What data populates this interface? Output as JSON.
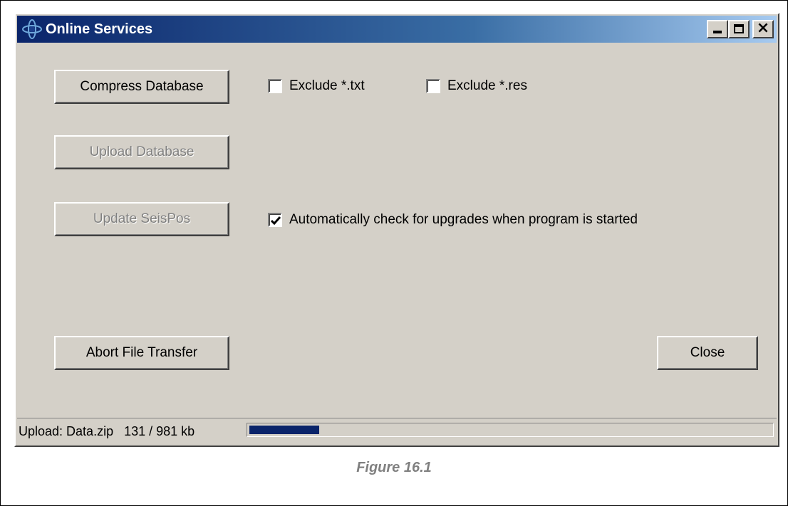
{
  "window": {
    "title": "Online Services",
    "icon": "satellite-icon"
  },
  "buttons": {
    "compress": "Compress Database",
    "upload": "Upload Database",
    "update": "Update SeisPos",
    "abort": "Abort File Transfer",
    "close": "Close"
  },
  "checkboxes": {
    "exclude_txt": {
      "label": "Exclude *.txt",
      "checked": false
    },
    "exclude_res": {
      "label": "Exclude *.res",
      "checked": false
    },
    "auto_check": {
      "label": "Automatically check for upgrades when program is started",
      "checked": true
    }
  },
  "status": {
    "text": "Upload: Data.zip   131 / 981 kb",
    "uploaded_kb": 131,
    "total_kb": 981
  },
  "caption": "Figure 16.1",
  "colors": {
    "title_gradient_start": "#0a246a",
    "title_gradient_end": "#a6caf0",
    "progress": "#0a246a",
    "face": "#d4d0c8"
  }
}
